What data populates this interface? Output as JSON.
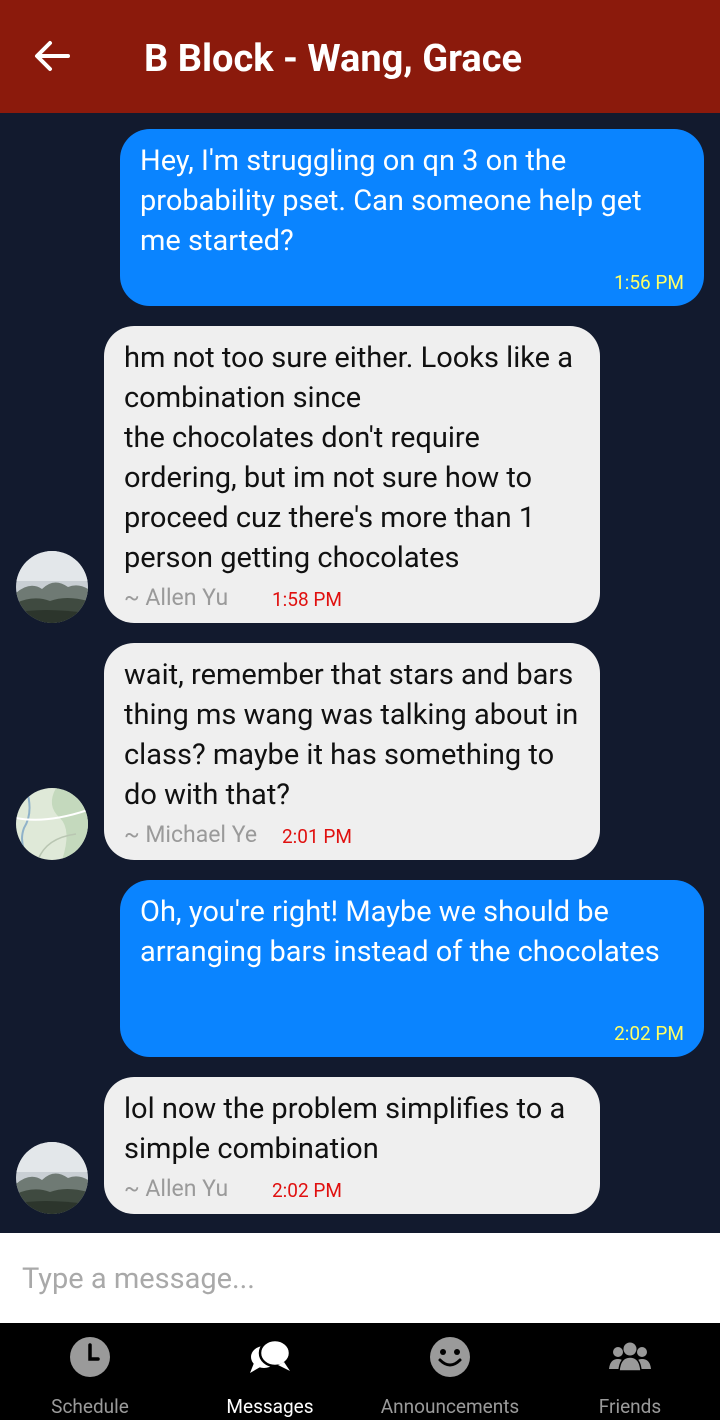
{
  "header": {
    "title": "B Block - Wang, Grace",
    "back_icon": "arrow-left-icon",
    "background": "#8b1a0c"
  },
  "messages": [
    {
      "side": "me",
      "text": "Hey, I'm struggling on qn 3 on the probability pset. Can someone help get me started?",
      "time": "1:56 PM"
    },
    {
      "side": "them",
      "text": "hm not too sure either. Looks like a combination since\nthe chocolates don't require ordering, but im not sure how to proceed cuz there's more than 1 person getting chocolates",
      "sender": "~ Allen Yu",
      "time": "1:58 PM",
      "avatar": "mountain-avatar"
    },
    {
      "side": "them",
      "text": "wait, remember that stars and bars thing ms wang was talking about in class? maybe it has something to do with that?",
      "sender": "~ Michael Ye",
      "time": "2:01 PM",
      "avatar": "map-avatar"
    },
    {
      "side": "me",
      "text": "Oh, you're right! Maybe we should be arranging bars instead of the chocolates",
      "time": "2:02 PM"
    },
    {
      "side": "them",
      "text": "lol now the problem simplifies to a simple combination",
      "sender": "~ Allen Yu",
      "time": "2:02 PM",
      "avatar": "mountain-avatar"
    }
  ],
  "composer": {
    "placeholder": "Type a message..."
  },
  "nav": {
    "items": [
      {
        "label": "Schedule",
        "icon": "clock-icon",
        "active": false
      },
      {
        "label": "Messages",
        "icon": "chat-bubbles-icon",
        "active": true
      },
      {
        "label": "Announcements",
        "icon": "smiley-icon",
        "active": false
      },
      {
        "label": "Friends",
        "icon": "people-icon",
        "active": false
      }
    ]
  },
  "colors": {
    "my_bubble": "#0a84ff",
    "their_bubble": "#efefef",
    "my_time": "#ffff66",
    "their_time": "#e0100f",
    "chat_background": "#121a2e"
  }
}
